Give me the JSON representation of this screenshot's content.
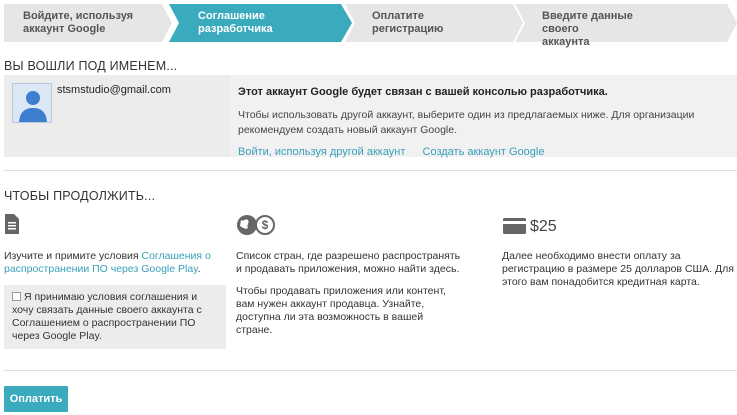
{
  "steps": [
    {
      "line1": "Войдите, используя",
      "line2": "аккаунт Google"
    },
    {
      "line1": "Соглашение",
      "line2": "разработчика"
    },
    {
      "line1": "Оплатите регистрацию",
      "line2": ""
    },
    {
      "line1": "Введите данные своего",
      "line2": "аккаунта"
    }
  ],
  "colors": {
    "accent": "#3aaabd",
    "step_bg": "#e6e6e6",
    "panel_bg": "#ececec",
    "link": "#3aa0b8"
  },
  "signed_in": {
    "title": "ВЫ ВОШЛИ ПОД ИМЕНЕМ...",
    "email": "stsmstudio@gmail.com",
    "notice_bold": "Этот аккаунт Google будет связан с вашей консолью разработчика.",
    "notice_desc": "Чтобы использовать другой аккаунт, выберите один из предлагаемых ниже. Для организации рекомендуем создать новый аккаунт Google.",
    "link_other": "Войти, используя другой аккаунт",
    "link_create": "Создать аккаунт Google"
  },
  "continue": {
    "title": "ЧТОБЫ ПРОДОЛЖИТЬ...",
    "col1_text_before": "Изучите и примите условия ",
    "col1_link": "Соглашения о распространении ПО через Google Play",
    "col1_text_after": ".",
    "agree_label": "Я принимаю условия соглашения и хочу связать данные своего аккаунта с Соглашением о распространении ПО через Google Play.",
    "col2_p1": "Список стран, где разрешено распространять и продавать приложения, можно найти здесь.",
    "col2_p2": "Чтобы продавать приложения или контент, вам нужен аккаунт продавца. Узнайте, доступна ли эта возможность в вашей стране.",
    "price": "$25",
    "col3_text": "Далее необходимо внести оплату за регистрацию в размере 25 долларов США. Для этого вам понадобится кредитная карта."
  },
  "pay_button": "Оплатить",
  "icons": {
    "doc": "document-icon",
    "globe": "globe-dollar-icon",
    "card": "credit-card-icon",
    "avatar": "user-avatar-icon"
  }
}
